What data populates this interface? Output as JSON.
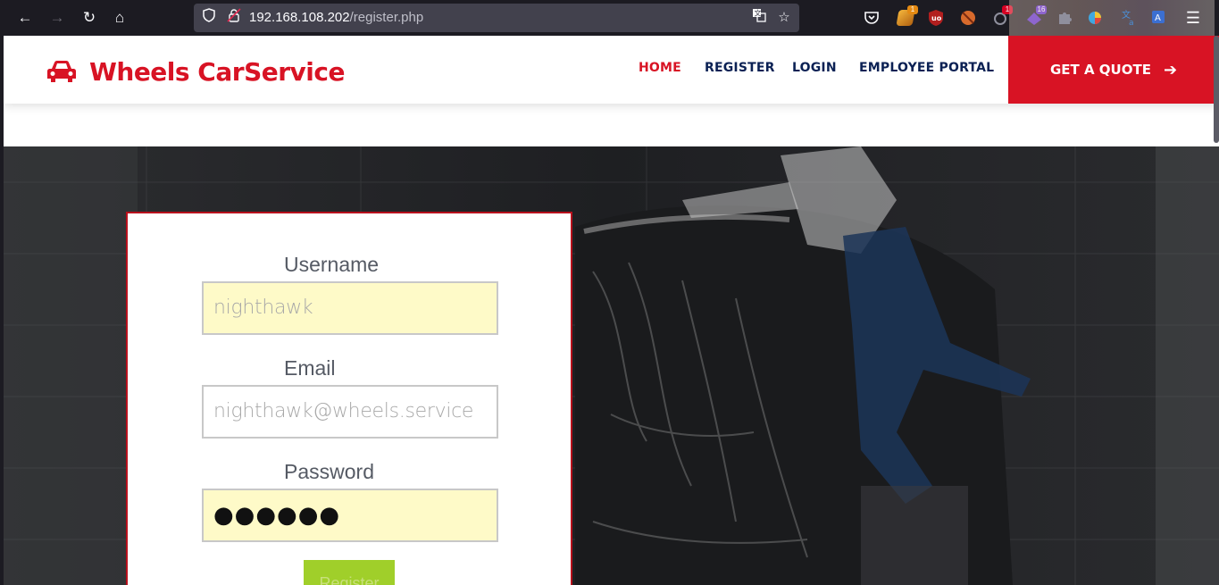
{
  "browser": {
    "url_host": "192.168.108.202",
    "url_path": "/register.php",
    "extensions": [
      {
        "name": "pocket-icon",
        "color": "#e04d5b",
        "badge": ""
      },
      {
        "name": "shield-extension-icon",
        "color": "#e58a12",
        "badge": "1",
        "badge_color": "#e58a12"
      },
      {
        "name": "ublock-icon",
        "color": "#b21f1f",
        "badge": ""
      },
      {
        "name": "cookie-icon",
        "color": "#d86a2c",
        "badge": ""
      },
      {
        "name": "extension-badge-icon",
        "color": "#8f8f9d",
        "badge": "1",
        "badge_color": "#d70022"
      },
      {
        "name": "purple-extension-icon",
        "color": "#5a2bd4",
        "badge": "16",
        "badge_color": "#5a2bd4"
      },
      {
        "name": "puzzle-icon",
        "color": "#8f8f9d",
        "badge": ""
      },
      {
        "name": "colorful-extension-icon",
        "color": "#3fa7e0",
        "badge": ""
      },
      {
        "name": "translate-icon",
        "color": "#4a90d9",
        "badge": ""
      },
      {
        "name": "font-translate-icon",
        "color": "#3b6fd1",
        "badge": ""
      }
    ]
  },
  "site": {
    "brand": "Wheels CarService",
    "nav": [
      "HOME",
      "REGISTER",
      "LOGIN",
      "EMPLOYEE PORTAL"
    ],
    "cta": "GET A QUOTE",
    "accent": "#d81324"
  },
  "form": {
    "username_label": "Username",
    "username_value": "nighthawk",
    "email_label": "Email",
    "email_value": "nighthawk@wheels.service",
    "password_label": "Password",
    "password_value": "●●●●●●",
    "submit_label": "Register"
  }
}
